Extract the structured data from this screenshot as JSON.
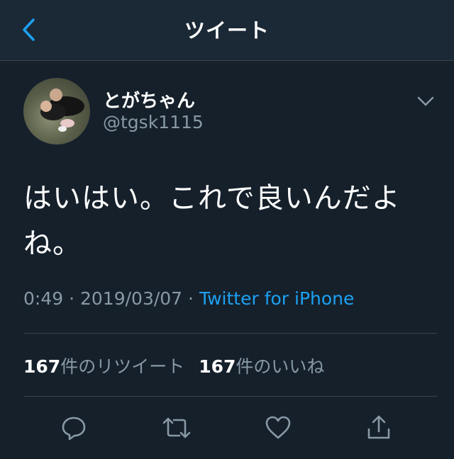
{
  "nav": {
    "title": "ツイート"
  },
  "tweet": {
    "display_name": "とがちゃん",
    "handle": "@tgsk1115",
    "text_line1": "はいはい。これで良いんだよ",
    "text_line2": "ね。",
    "time": "0:49",
    "dot1": "·",
    "date": "2019/03/07",
    "dot2": "·",
    "source": "Twitter for iPhone"
  },
  "stats": {
    "retweet_count": "167",
    "retweet_label": "件のリツイート",
    "like_count": "167",
    "like_label": "件のいいね"
  },
  "colors": {
    "background": "#15202b",
    "nav_background": "#1b2836",
    "accent": "#1da1f2",
    "secondary_text": "#8899a6",
    "divider": "#38444d"
  },
  "icons": {
    "back": "chevron-left-icon",
    "menu": "chevron-down-icon",
    "reply": "reply-bubble-icon",
    "retweet": "retweet-icon",
    "like": "heart-icon",
    "share": "share-icon"
  }
}
